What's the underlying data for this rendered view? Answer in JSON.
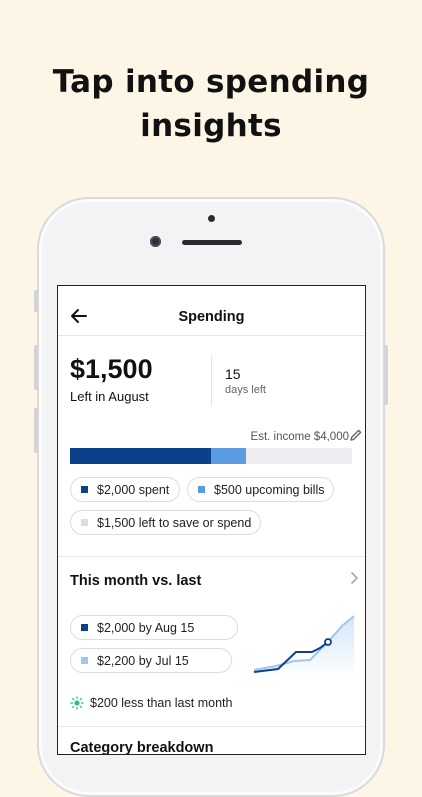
{
  "headline": {
    "line1": "Tap into spending",
    "line2": "insights"
  },
  "nav": {
    "title": "Spending"
  },
  "summary": {
    "amount": "$1,500",
    "amount_label": "Left in August",
    "days": "15",
    "days_label": "days left"
  },
  "budget": {
    "income_label": "Est. income $4,000",
    "spent_fraction": 0.5,
    "bills_fraction": 0.125,
    "chips": {
      "spent": "$2,000 spent",
      "bills": "$500 upcoming bills",
      "left": "$1,500 left to save or spend"
    }
  },
  "comparison": {
    "title": "This month vs. last",
    "this_month": "$2,000 by Aug 15",
    "last_month": "$2,200 by Jul 15",
    "tip": "$200 less than last month"
  },
  "category": {
    "title": "Category breakdown"
  },
  "colors": {
    "spent": "#0c4189",
    "bills": "#5b9be0",
    "left": "#dcdce2",
    "last_month": "#9ec6f0",
    "tip_icon": "#3bb59a"
  },
  "icons": {
    "back": "arrow-left-icon",
    "edit": "pencil-icon",
    "chevron": "chevron-right-icon",
    "tip": "sun-icon"
  }
}
